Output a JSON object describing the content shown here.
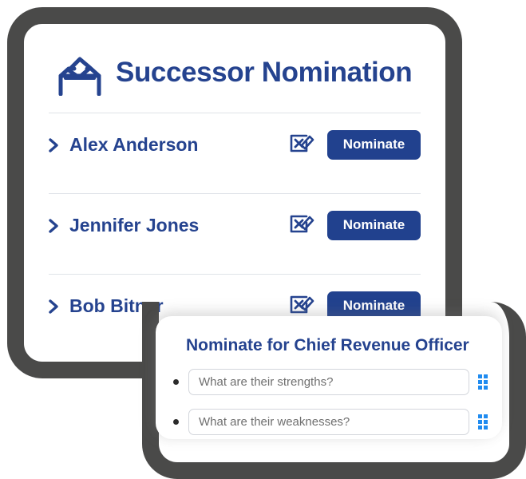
{
  "main_card": {
    "icon": "ballot-box-icon",
    "title": "Successor Nomination",
    "people": [
      {
        "name": "Alex Anderson",
        "expand_icon": "chevron-right-icon",
        "edit_icon": "edit-checkbox-icon",
        "action_label": "Nominate"
      },
      {
        "name": "Jennifer Jones",
        "expand_icon": "chevron-right-icon",
        "edit_icon": "edit-checkbox-icon",
        "action_label": "Nominate"
      },
      {
        "name": "Bob Bitner",
        "expand_icon": "chevron-right-icon",
        "edit_icon": "edit-checkbox-icon",
        "action_label": "Nominate"
      }
    ]
  },
  "overlay_card": {
    "title": "Nominate for Chief Revenue Officer",
    "fields": [
      {
        "placeholder": "What are their strengths?",
        "value": "",
        "handle_icon": "drag-handle-icon"
      },
      {
        "placeholder": "What are their weaknesses?",
        "value": "",
        "handle_icon": "drag-handle-icon"
      }
    ]
  },
  "colors": {
    "brand_navy": "#25438f",
    "button_navy": "#21418e",
    "frame_gray": "#4a4a49",
    "divider_gray": "#dfe3e8",
    "handle_blue": "#1f8bf0"
  }
}
